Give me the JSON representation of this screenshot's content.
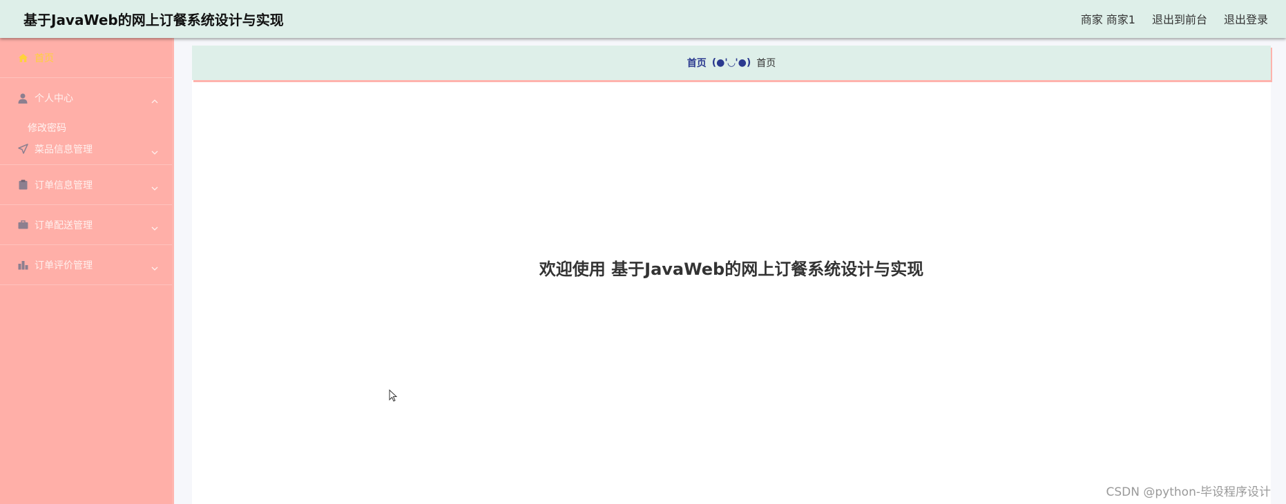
{
  "header": {
    "title": "基于JavaWeb的网上订餐系统设计与实现",
    "user_label": "商家 商家1",
    "front_link": "退出到前台",
    "logout_link": "退出登录"
  },
  "sidebar": {
    "items": [
      {
        "label": "首页",
        "icon": "home-icon",
        "active": true
      },
      {
        "label": "个人中心",
        "icon": "user-icon",
        "expanded": true,
        "children": [
          {
            "label": "修改密码"
          }
        ]
      },
      {
        "label": "菜品信息管理",
        "icon": "send-icon"
      },
      {
        "label": "订单信息管理",
        "icon": "clipboard-icon"
      },
      {
        "label": "订单配送管理",
        "icon": "briefcase-icon"
      },
      {
        "label": "订单评价管理",
        "icon": "chart-icon"
      }
    ]
  },
  "breadcrumb": {
    "home": "首页",
    "separator": "(●'◡'●)",
    "current": "首页"
  },
  "main": {
    "welcome": "欢迎使用 基于JavaWeb的网上订餐系统设计与实现"
  },
  "watermark": "CSDN @python-毕设程序设计",
  "colors": {
    "header_bg": "#deefe9",
    "sidebar_bg": "#ffafa8",
    "active_label": "#ffd23a",
    "breadcrumb_accent": "#2b3a8f"
  }
}
